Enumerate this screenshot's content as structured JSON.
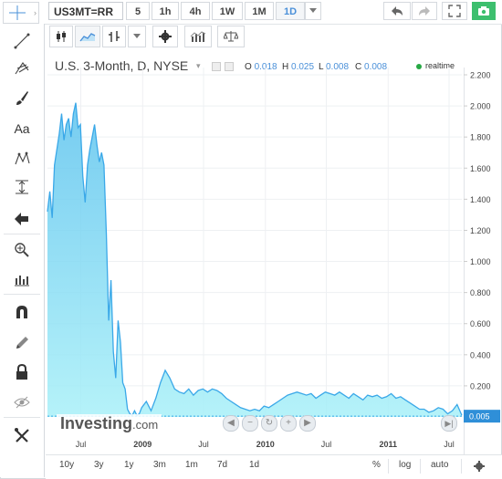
{
  "toolbar": {
    "symbol": "US3MT=RR",
    "timeframes": [
      "5",
      "1h",
      "4h",
      "1W",
      "1M",
      "1D"
    ],
    "active_timeframe": "1D"
  },
  "legend": {
    "title": "U.S. 3-Month, D, NYSE",
    "ohlc": [
      {
        "label": "O",
        "value": "0.018"
      },
      {
        "label": "H",
        "value": "0.025"
      },
      {
        "label": "L",
        "value": "0.008"
      },
      {
        "label": "C",
        "value": "0.008"
      }
    ],
    "status": "realtime"
  },
  "branding": {
    "name": "Investing",
    "suffix": ".com"
  },
  "bottom_bar": {
    "ranges": [
      "10y",
      "3y",
      "1y",
      "3m",
      "1m",
      "7d",
      "1d"
    ],
    "percent_label": "%",
    "log_label": "log",
    "auto_label": "auto"
  },
  "colors": {
    "line": "#3aa8e8",
    "fill_top": "#5ec3ee",
    "fill_bottom": "#a8f0f8",
    "price_label_bg": "#2f8fd8",
    "accent": "#4a90d9"
  },
  "chart_data": {
    "type": "area",
    "title": "U.S. 3-Month, D, NYSE",
    "x_ticks": [
      "Jul",
      "2009",
      "Jul",
      "2010",
      "Jul",
      "2011",
      "Jul"
    ],
    "y_ticks": [
      "2.200",
      "2.000",
      "1.800",
      "1.600",
      "1.400",
      "1.200",
      "1.000",
      "0.800",
      "0.600",
      "0.400",
      "0.200"
    ],
    "ylim": [
      0,
      2.2
    ],
    "last_value": "0.005",
    "grid": true,
    "series": [
      {
        "x": [
          "2008-03-24",
          "2008-03-31",
          "2008-04-07",
          "2008-04-14",
          "2008-04-21",
          "2008-04-28",
          "2008-05-05",
          "2008-05-12",
          "2008-05-19",
          "2008-05-26",
          "2008-06-02",
          "2008-06-09",
          "2008-06-16",
          "2008-06-23",
          "2008-06-30",
          "2008-07-07",
          "2008-07-14",
          "2008-07-21",
          "2008-07-28",
          "2008-08-04",
          "2008-08-11",
          "2008-08-18",
          "2008-08-25",
          "2008-09-01",
          "2008-09-08",
          "2008-09-15",
          "2008-09-22",
          "2008-09-29",
          "2008-10-06",
          "2008-10-13",
          "2008-10-20",
          "2008-10-27",
          "2008-11-03",
          "2008-11-10",
          "2008-11-17",
          "2008-11-24",
          "2008-12-01",
          "2008-12-08",
          "2008-12-15",
          "2008-12-22",
          "2008-12-29",
          "2009-01-12",
          "2009-01-26",
          "2009-02-09",
          "2009-02-23",
          "2009-03-09",
          "2009-03-23",
          "2009-04-06",
          "2009-04-20",
          "2009-05-04",
          "2009-05-18",
          "2009-06-01",
          "2009-06-15",
          "2009-06-29",
          "2009-07-13",
          "2009-07-27",
          "2009-08-10",
          "2009-08-24",
          "2009-09-07",
          "2009-09-21",
          "2009-10-05",
          "2009-10-19",
          "2009-11-02",
          "2009-11-16",
          "2009-11-30",
          "2009-12-14",
          "2009-12-28",
          "2010-01-11",
          "2010-01-25",
          "2010-02-08",
          "2010-02-22",
          "2010-03-08",
          "2010-03-22",
          "2010-04-05",
          "2010-04-19",
          "2010-05-03",
          "2010-05-17",
          "2010-05-31",
          "2010-06-14",
          "2010-06-28",
          "2010-07-12",
          "2010-07-26",
          "2010-08-09",
          "2010-08-23",
          "2010-09-06",
          "2010-09-20",
          "2010-10-04",
          "2010-10-18",
          "2010-11-01",
          "2010-11-15",
          "2010-11-29",
          "2010-12-13",
          "2010-12-27",
          "2011-01-10",
          "2011-01-24",
          "2011-02-07",
          "2011-02-21",
          "2011-03-07",
          "2011-03-21",
          "2011-04-04",
          "2011-04-18",
          "2011-05-02",
          "2011-05-16",
          "2011-05-30",
          "2011-06-13",
          "2011-06-27",
          "2011-07-11",
          "2011-07-25",
          "2011-08-08"
        ],
        "values": [
          1.32,
          1.45,
          1.28,
          1.62,
          1.72,
          1.82,
          1.95,
          1.78,
          1.88,
          1.92,
          1.8,
          1.95,
          2.02,
          1.86,
          1.88,
          1.55,
          1.38,
          1.62,
          1.72,
          1.8,
          1.88,
          1.75,
          1.64,
          1.7,
          1.62,
          1.18,
          0.62,
          0.88,
          0.42,
          0.25,
          0.62,
          0.48,
          0.22,
          0.18,
          0.05,
          0.02,
          0.01,
          0.04,
          0.01,
          0.02,
          0.06,
          0.1,
          0.04,
          0.12,
          0.22,
          0.3,
          0.25,
          0.18,
          0.16,
          0.15,
          0.18,
          0.14,
          0.17,
          0.18,
          0.16,
          0.18,
          0.17,
          0.15,
          0.12,
          0.1,
          0.08,
          0.06,
          0.05,
          0.04,
          0.05,
          0.04,
          0.07,
          0.06,
          0.08,
          0.1,
          0.12,
          0.14,
          0.15,
          0.16,
          0.15,
          0.14,
          0.15,
          0.12,
          0.14,
          0.16,
          0.15,
          0.14,
          0.16,
          0.14,
          0.12,
          0.15,
          0.13,
          0.11,
          0.14,
          0.13,
          0.14,
          0.12,
          0.13,
          0.15,
          0.12,
          0.13,
          0.11,
          0.09,
          0.07,
          0.05,
          0.05,
          0.03,
          0.04,
          0.06,
          0.05,
          0.02,
          0.04,
          0.08,
          0.01
        ]
      }
    ]
  }
}
